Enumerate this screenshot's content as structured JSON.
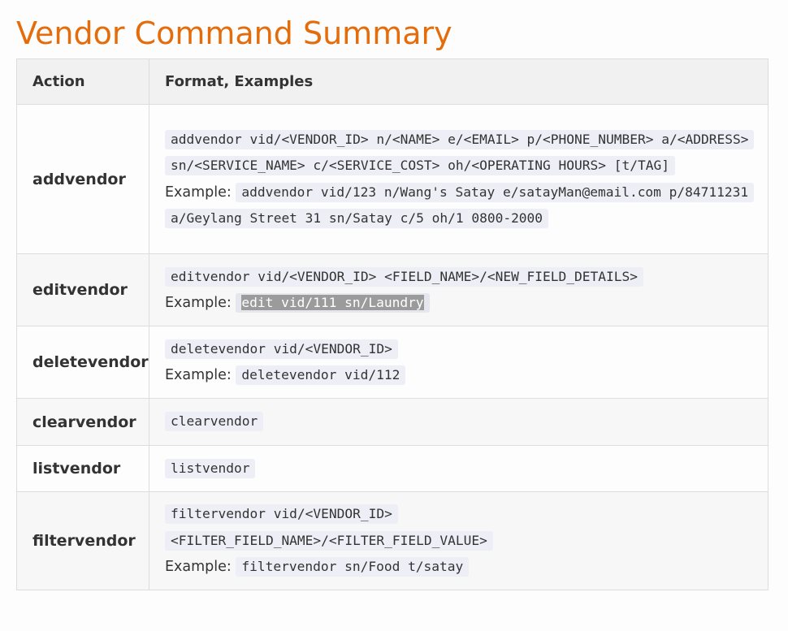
{
  "title": "Vendor Command Summary",
  "table": {
    "headers": [
      "Action",
      "Format, Examples"
    ],
    "example_label": "Example:",
    "rows": [
      {
        "action": "addvendor",
        "format": "addvendor vid/<VENDOR_ID> n/<NAME> e/<EMAIL> p/<PHONE_NUMBER> a/<ADDRESS> sn/<SERVICE_NAME> c/<SERVICE_COST> oh/<OPERATING HOURS> [t/TAG]",
        "example": "addvendor vid/123 n/Wang's Satay e/satayMan@email.com p/84711231 a/Geylang Street 31 sn/Satay c/5 oh/1 0800-2000"
      },
      {
        "action": "editvendor",
        "format": "editvendor vid/<VENDOR_ID> <FIELD_NAME>/<NEW_FIELD_DETAILS>",
        "example": "edit vid/111 sn/Laundry"
      },
      {
        "action": "deletevendor",
        "format": "deletevendor vid/<VENDOR_ID>",
        "example": "deletevendor vid/112"
      },
      {
        "action": "clearvendor",
        "format": "clearvendor"
      },
      {
        "action": "listvendor",
        "format": "listvendor"
      },
      {
        "action": "filtervendor",
        "format_line1": "filtervendor vid/<VENDOR_ID>",
        "format_line2": "<FILTER_FIELD_NAME>/<FILTER_FIELD_VALUE>",
        "example": "filtervendor sn/Food t/satay"
      }
    ]
  },
  "colors": {
    "title": "#e46c0a",
    "header_bg": "#f1f1f1",
    "code_bg": "#eeeef6",
    "selection": "#9b9b9b"
  }
}
